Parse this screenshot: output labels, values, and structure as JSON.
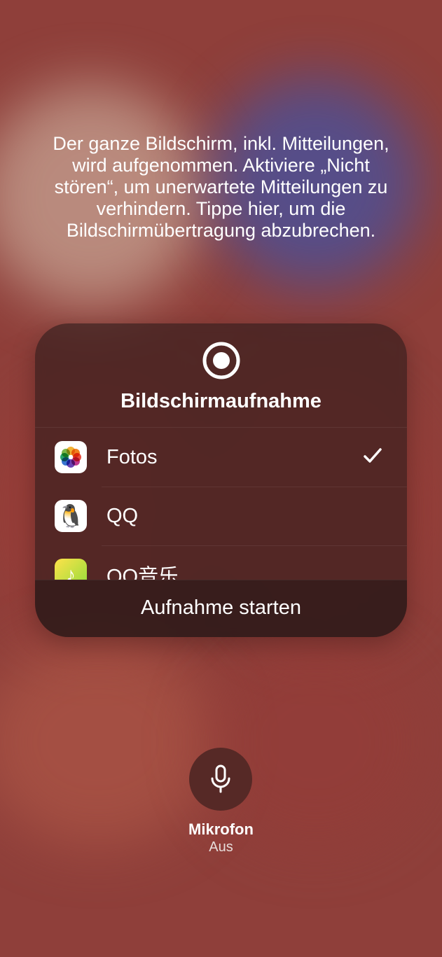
{
  "info_text": "Der ganze Bildschirm, inkl. Mitteilungen, wird aufgenommen. Aktiviere „Nicht stören“, um unerwartete Mitteilungen zu verhindern. Tippe hier, um die Bildschirmübertragung abzubrechen.",
  "panel": {
    "title": "Bildschirmaufnahme",
    "apps": [
      {
        "label": "Fotos",
        "icon": "photos",
        "selected": true
      },
      {
        "label": "QQ",
        "icon": "qq",
        "selected": false
      },
      {
        "label": "QQ音乐",
        "icon": "qqmusic",
        "selected": false
      }
    ],
    "start_label": "Aufnahme starten"
  },
  "microphone": {
    "label": "Mikrofon",
    "state": "Aus"
  }
}
